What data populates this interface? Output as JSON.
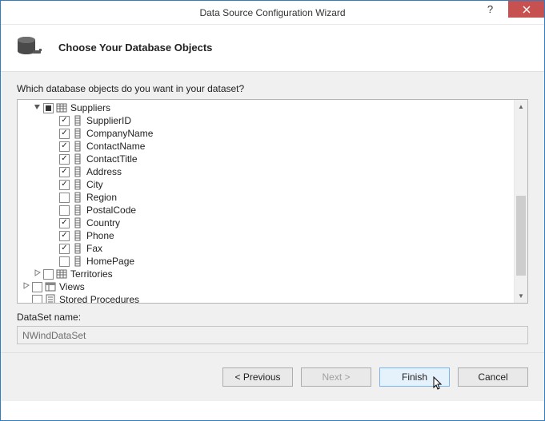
{
  "window": {
    "title": "Data Source Configuration Wizard"
  },
  "header": {
    "title": "Choose Your Database Objects"
  },
  "content": {
    "prompt": "Which database objects do you want in your dataset?",
    "dataset_label": "DataSet name:",
    "dataset_name": "NWindDataSet"
  },
  "tree": {
    "suppliers_label": "Suppliers",
    "columns": [
      {
        "label": "SupplierID",
        "checked": true
      },
      {
        "label": "CompanyName",
        "checked": true
      },
      {
        "label": "ContactName",
        "checked": true
      },
      {
        "label": "ContactTitle",
        "checked": true
      },
      {
        "label": "Address",
        "checked": true
      },
      {
        "label": "City",
        "checked": true
      },
      {
        "label": "Region",
        "checked": false
      },
      {
        "label": "PostalCode",
        "checked": false
      },
      {
        "label": "Country",
        "checked": true
      },
      {
        "label": "Phone",
        "checked": true
      },
      {
        "label": "Fax",
        "checked": true
      },
      {
        "label": "HomePage",
        "checked": false
      }
    ],
    "territories_label": "Territories",
    "views_label": "Views",
    "sprocs_label": "Stored Procedures"
  },
  "buttons": {
    "previous": "< Previous",
    "next": "Next >",
    "finish": "Finish",
    "cancel": "Cancel"
  }
}
